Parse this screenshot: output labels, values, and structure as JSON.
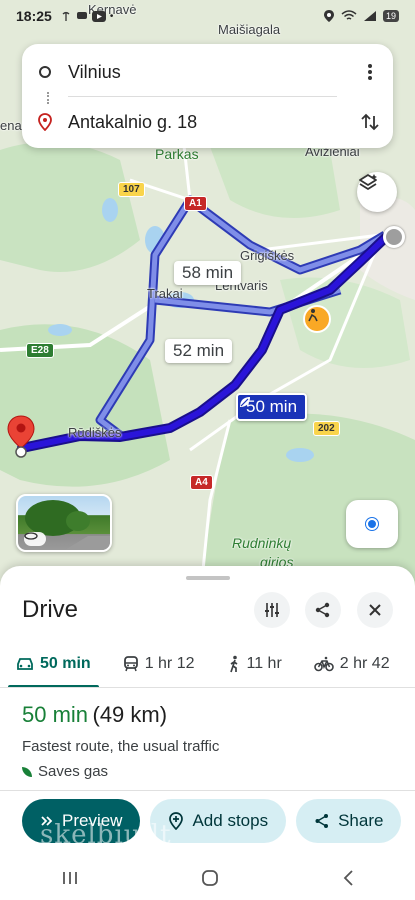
{
  "status_bar": {
    "time": "18:25",
    "left_icons": [
      "location-icon",
      "wifi-icon",
      "signal-icon",
      "battery-icon"
    ],
    "battery": "19"
  },
  "search": {
    "origin": "Vilnius",
    "destination": "Antakalnio g. 18"
  },
  "map": {
    "places": {
      "kernave": "Kernavė",
      "maisiagala": "Maišiagala",
      "parkas": "Parkas",
      "avizieniai": "Avižieniai",
      "grigiskes": "Grigiškės",
      "lentvaris": "Lentvaris",
      "trakai": "Trakai",
      "rudiskes": "Rūdiškės",
      "rudninku": "Rudninkų",
      "girios": "girios",
      "enai": "enai"
    },
    "shields": {
      "r107": "107",
      "a1": "A1",
      "e28": "E28",
      "r202": "202",
      "a4": "A4"
    },
    "route_labels": {
      "alt1": "58 min",
      "alt2": "52 min",
      "main": "50 min"
    }
  },
  "sheet": {
    "title": "Drive",
    "modes": [
      {
        "icon": "car-icon",
        "label": "50 min"
      },
      {
        "icon": "transit-icon",
        "label": "1 hr 12"
      },
      {
        "icon": "walk-icon",
        "label": "11 hr"
      },
      {
        "icon": "bike-icon",
        "label": "2 hr 42"
      }
    ],
    "summary": {
      "duration": "50 min",
      "distance": "(49 km)",
      "description": "Fastest route, the usual traffic",
      "eco": "Saves gas"
    },
    "actions": {
      "preview": "Preview",
      "add_stops": "Add stops",
      "share": "Share"
    }
  },
  "watermark": "skelbiu.lt",
  "colors": {
    "route_main": "#2a14d9",
    "route_alt": "#6b7be0",
    "accent_teal": "#006064",
    "duration_green": "#188038"
  }
}
